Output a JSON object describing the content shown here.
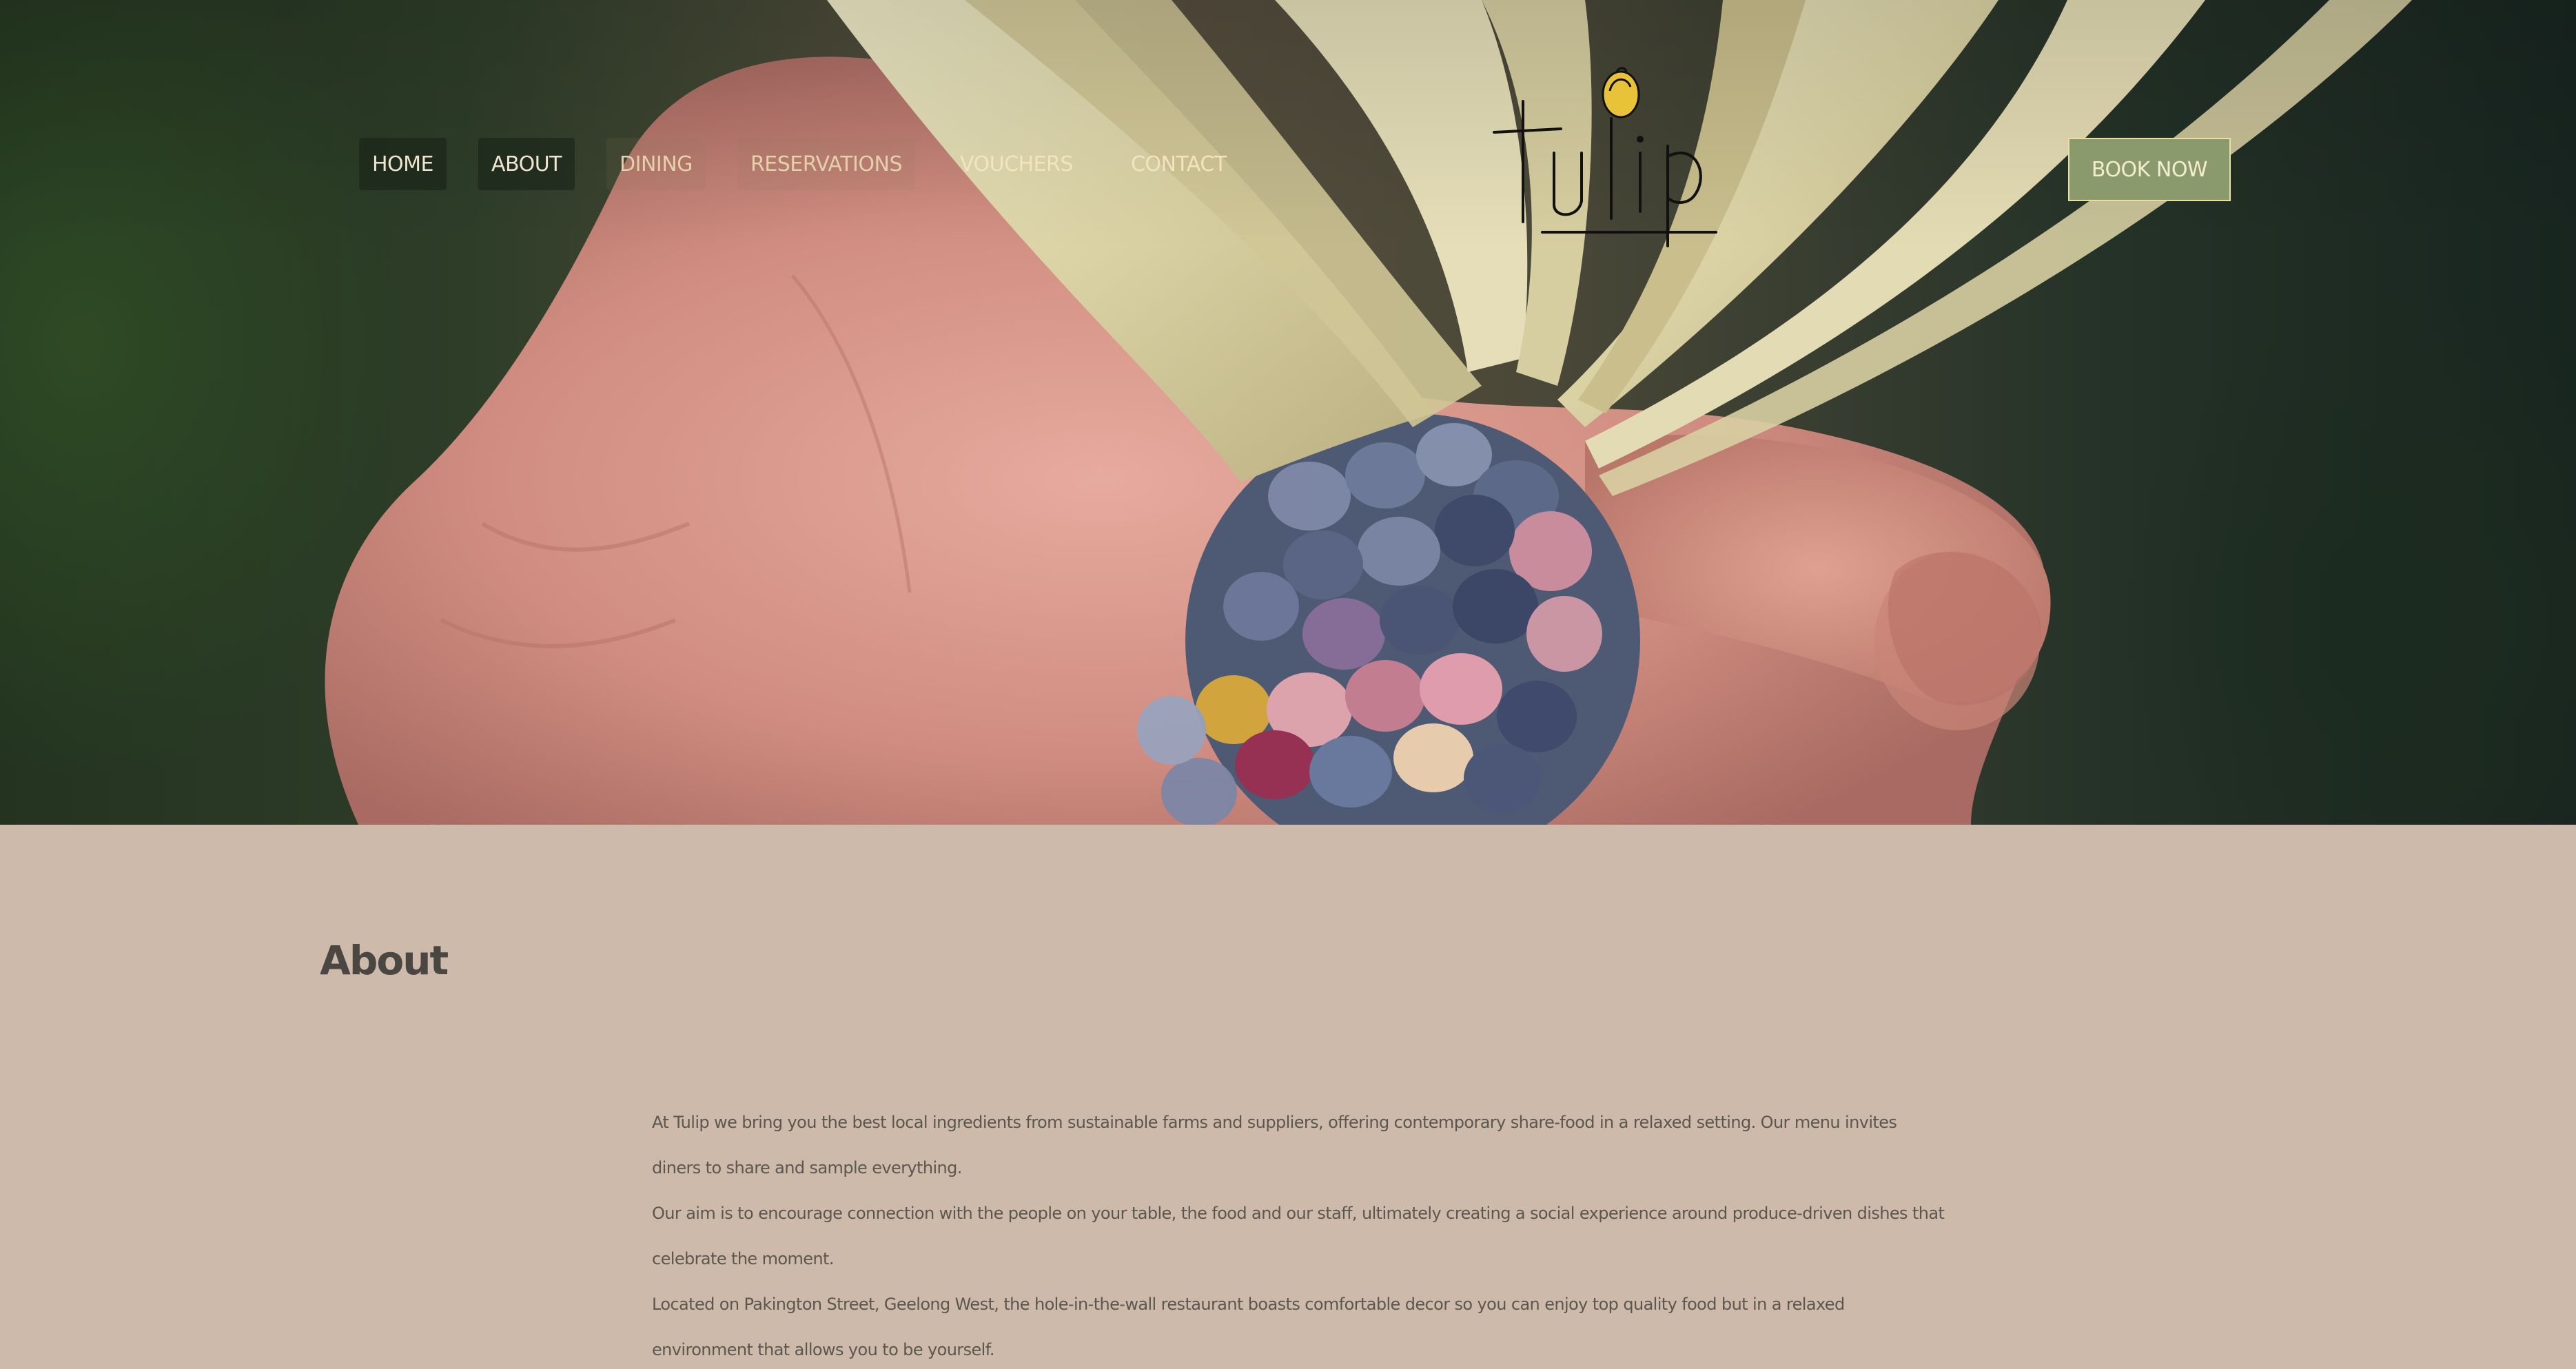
{
  "nav": {
    "items": [
      {
        "label": "HOME"
      },
      {
        "label": "ABOUT"
      },
      {
        "label": "DINING"
      },
      {
        "label": "RESERVATIONS"
      },
      {
        "label": "VOUCHERS"
      },
      {
        "label": "CONTACT"
      }
    ]
  },
  "logo": {
    "text": "tulip"
  },
  "book_button": {
    "label": "BOOK NOW"
  },
  "about": {
    "title": "About",
    "paragraphs": [
      "At Tulip we bring you the best local ingredients from sustainable farms and suppliers, offering contemporary share-food in a relaxed setting. Our menu invites diners to share and sample everything.",
      "Our aim is to encourage connection with the people on your table, the food and our staff, ultimately creating a social experience around produce-driven dishes that celebrate the moment.",
      "Located on Pakington Street, Geelong West, the hole-in-the-wall restaurant boasts comfortable decor so you can enjoy top quality food but in a relaxed environment that allows you to be yourself."
    ]
  },
  "colors": {
    "background": "#cebaab",
    "button": "#8b9a6c",
    "button_border": "#e8dfa2",
    "logo_accent": "#e8c33a"
  },
  "icons": {
    "logo_bulb": "tulip-bulb-icon"
  }
}
